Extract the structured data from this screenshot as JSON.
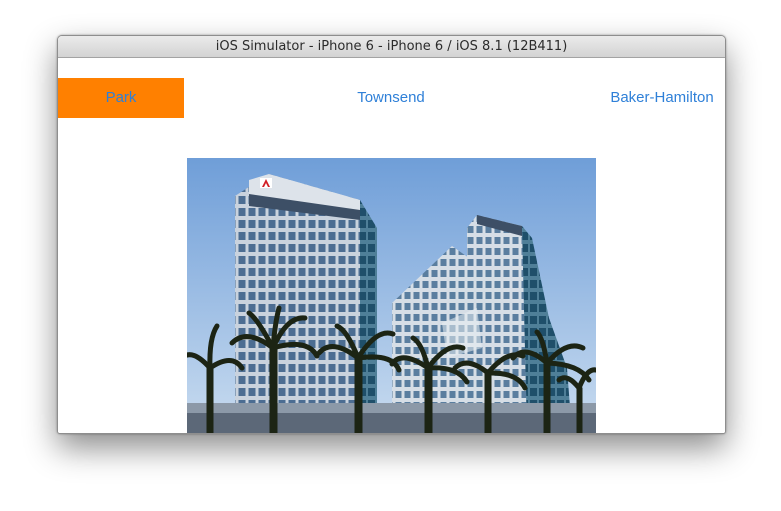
{
  "window": {
    "title": "iOS Simulator - iPhone 6 - iPhone 6 / iOS 8.1 (12B411)"
  },
  "tabs": [
    {
      "label": "Park",
      "selected": true
    },
    {
      "label": "Townsend",
      "selected": false
    },
    {
      "label": "Baker-Hamilton",
      "selected": false
    }
  ],
  "colors": {
    "selected_tab_bg": "#ff8000",
    "tab_text": "#2f80d8",
    "selected_tab_text": "#2f80d8"
  },
  "photo": {
    "subject": "office-towers-with-palm-trees-photo"
  }
}
